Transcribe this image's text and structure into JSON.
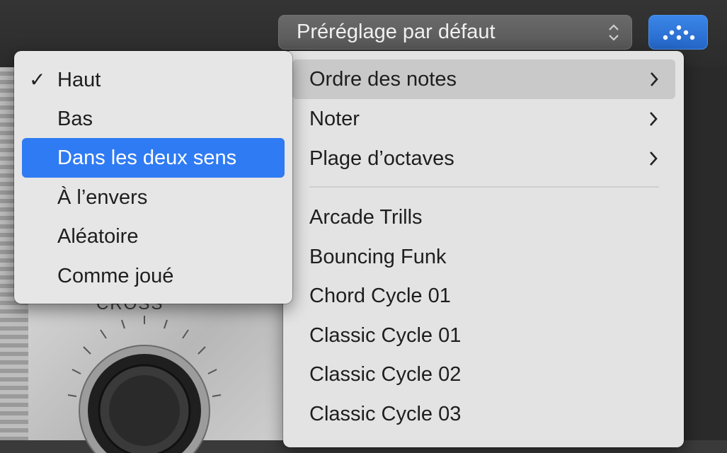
{
  "toolbar": {
    "preset_value": "Préréglage par défaut",
    "arpeggiator_icon": "arpeggiator-dots-icon",
    "accent_color": "#2f7bf3"
  },
  "plate": {
    "label": "CROSS"
  },
  "main_menu": {
    "submenus": [
      {
        "label": "Ordre des notes",
        "highlighted": true
      },
      {
        "label": "Noter"
      },
      {
        "label": "Plage d’octaves"
      }
    ],
    "presets": [
      "Arcade Trills",
      "Bouncing Funk",
      "Chord Cycle 01",
      "Classic Cycle 01",
      "Classic Cycle 02",
      "Classic Cycle 03"
    ]
  },
  "note_order_menu": {
    "checked_index": 0,
    "selected_index": 2,
    "check_glyph": "✓",
    "items": [
      "Haut",
      "Bas",
      "Dans les deux sens",
      "À l’envers",
      "Aléatoire",
      "Comme joué"
    ]
  }
}
